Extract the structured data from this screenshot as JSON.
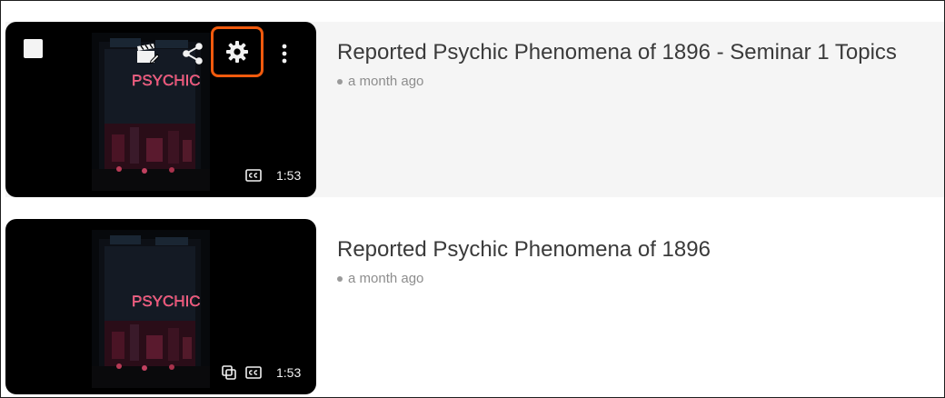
{
  "videos": [
    {
      "title": "Reported Psychic Phenomena of 1896 - Seminar 1 Topics",
      "age": "a month ago",
      "duration": "1:53",
      "thumbnail_sign": "PSYCHIC",
      "hovered": true,
      "badges": [
        "closed-captions-icon"
      ]
    },
    {
      "title": "Reported Psychic Phenomena of 1896",
      "age": "a month ago",
      "duration": "1:53",
      "thumbnail_sign": "PSYCHIC",
      "hovered": false,
      "badges": [
        "linked-copy-icon",
        "closed-captions-icon"
      ]
    }
  ],
  "hover_actions": [
    "select-checkbox",
    "clapperboard-edit-icon",
    "share-icon",
    "settings-gear-icon",
    "more-vertical-icon"
  ],
  "colors": {
    "highlight": "#f15a0d",
    "row_hover_bg": "#f5f5f5",
    "title": "#3a3a3a",
    "meta": "#8d8d8d"
  }
}
